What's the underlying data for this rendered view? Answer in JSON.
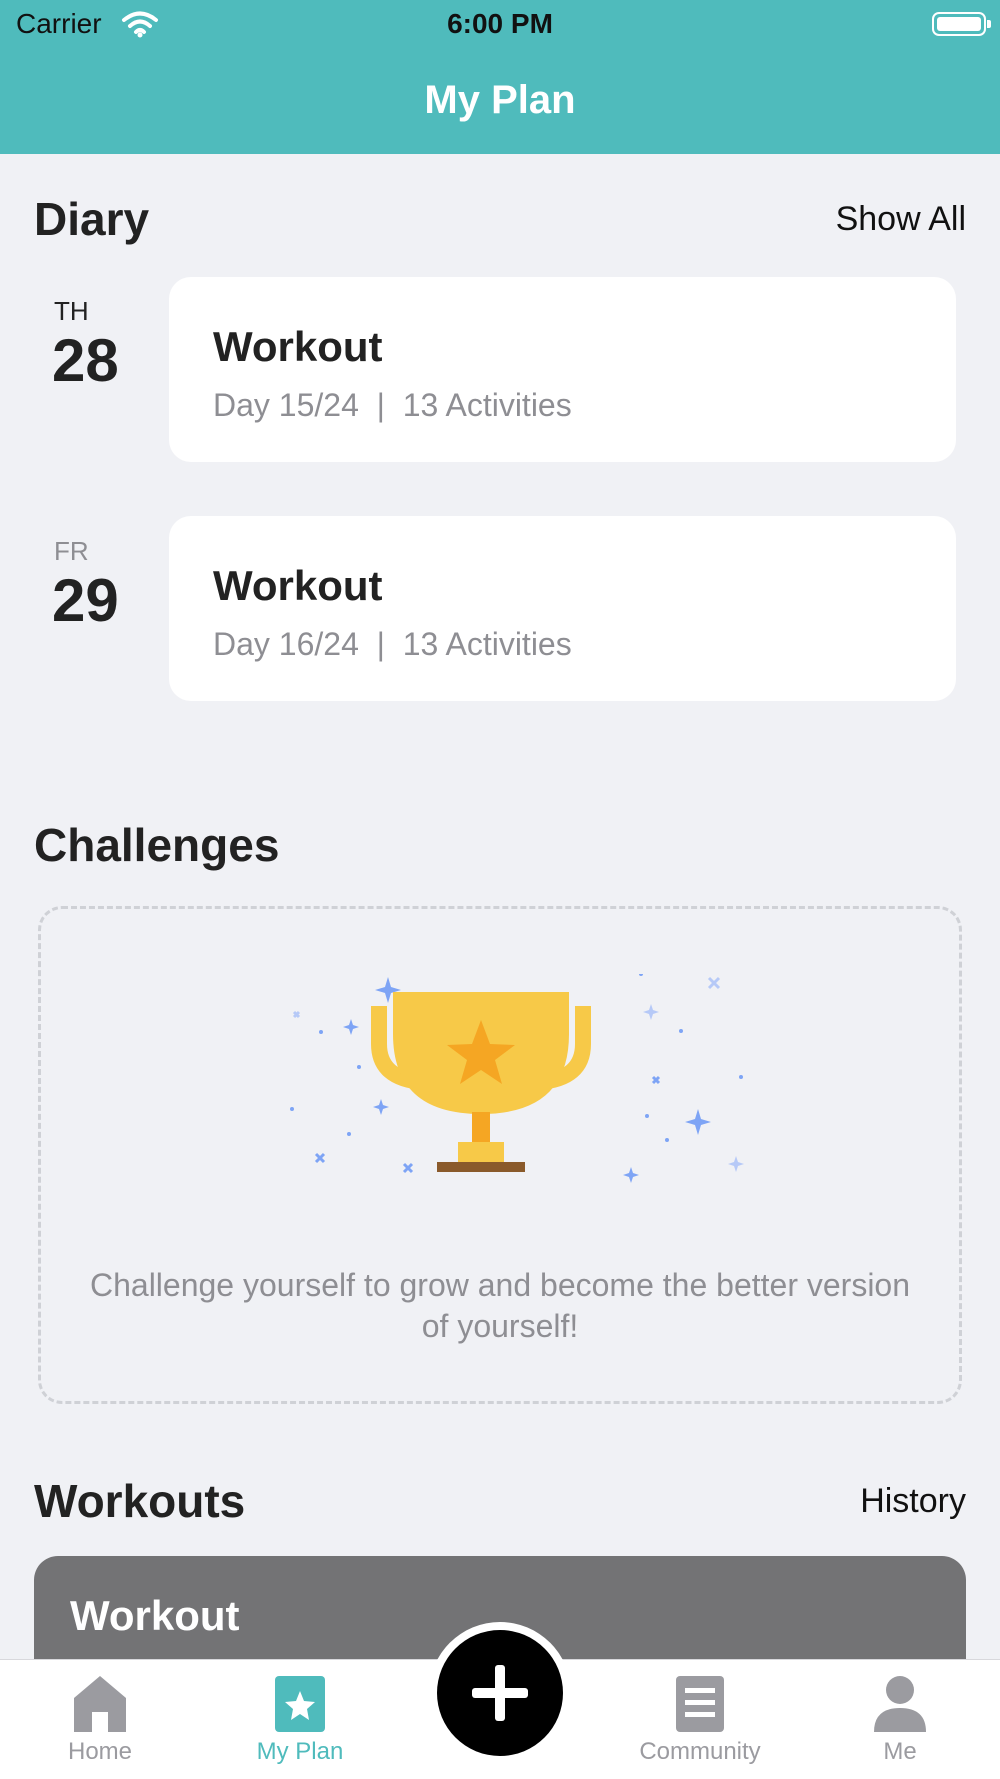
{
  "status_bar": {
    "carrier": "Carrier",
    "time": "6:00 PM"
  },
  "nav": {
    "title": "My Plan"
  },
  "diary": {
    "title": "Diary",
    "show_all_label": "Show All",
    "entries": [
      {
        "day_abbr": "TH",
        "day_num": "28",
        "title": "Workout",
        "subtitle": "Day 15/24  |  13 Activities"
      },
      {
        "day_abbr": "FR",
        "day_num": "29",
        "title": "Workout",
        "subtitle": "Day 16/24  |  13 Activities"
      }
    ]
  },
  "challenges": {
    "title": "Challenges",
    "empty_text": "Challenge yourself to grow and become the better version of yourself!"
  },
  "workouts": {
    "title": "Workouts",
    "history_label": "History",
    "card_title": "Workout"
  },
  "tab_bar": {
    "items": [
      {
        "label": "Home",
        "icon": "home-icon"
      },
      {
        "label": "My Plan",
        "icon": "star-badge-icon",
        "active": true
      },
      {
        "label": "",
        "icon": "plus-icon"
      },
      {
        "label": "Community",
        "icon": "document-icon"
      },
      {
        "label": "Me",
        "icon": "person-icon"
      }
    ]
  },
  "colors": {
    "accent": "#4fbbbc",
    "background": "#f0f1f5",
    "trophy": "#f7c948",
    "inactive_tab": "#9b9ba0"
  }
}
